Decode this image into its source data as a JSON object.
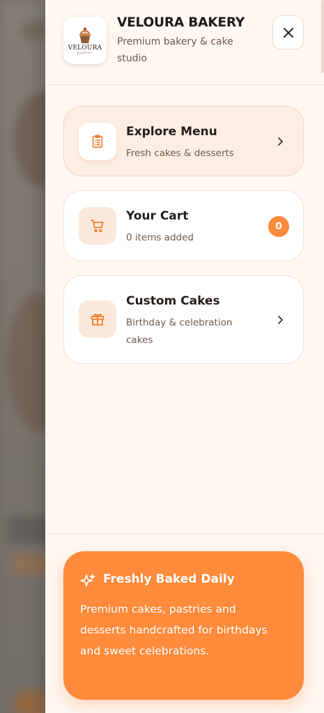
{
  "brand": {
    "logo_name": "VELOURA",
    "logo_sub": "BAKERY",
    "title": "VELOURA BAKERY",
    "subtitle": "Premium bakery & cake studio"
  },
  "menu": {
    "explore": {
      "title": "Explore Menu",
      "subtitle": "Fresh cakes & desserts",
      "icon": "clipboard-list-icon"
    },
    "cart": {
      "title": "Your Cart",
      "subtitle": "0 items added",
      "badge": "0",
      "icon": "cart-icon"
    },
    "custom": {
      "title": "Custom Cakes",
      "subtitle": "Birthday & celebration cakes",
      "icon": "gift-icon"
    }
  },
  "promo": {
    "title": "Freshly Baked Daily",
    "text": "Premium cakes, pastries and desserts handcrafted for birthdays and sweet celebrations.",
    "icon": "sparkles-icon"
  },
  "colors": {
    "accent": "#fe8a3b",
    "drawer_bg": "#fff7f2",
    "active_card": "#fdeee3",
    "text_dark": "#1f1b18",
    "text_muted": "#6d5a4a"
  }
}
